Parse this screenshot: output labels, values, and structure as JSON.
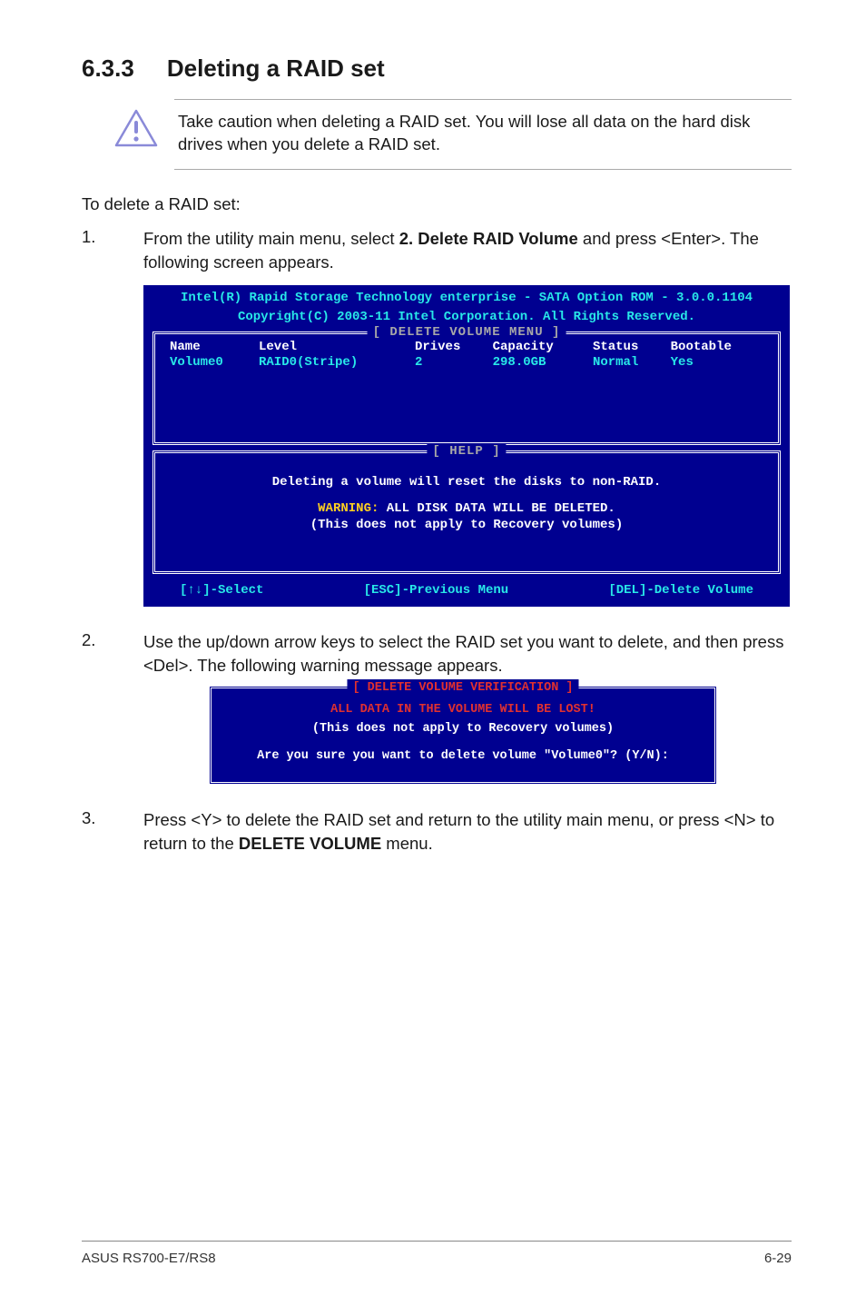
{
  "heading": {
    "number": "6.3.3",
    "title": "Deleting a RAID set"
  },
  "caution": "Take caution when deleting a RAID set. You will lose all data on the hard disk drives when you delete a RAID set.",
  "intro": "To delete a RAID set:",
  "steps": {
    "1": {
      "num": "1.",
      "pre": "From the utility main menu, select ",
      "bold": "2. Delete RAID Volume",
      "post": " and press <Enter>. The following screen appears."
    },
    "2": {
      "num": "2.",
      "text": "Use the up/down arrow keys to select the RAID set you want to delete, and then press <Del>. The following warning message appears."
    },
    "3": {
      "num": "3.",
      "pre": "Press <Y> to delete the RAID set and return to the utility main menu, or press <N> to return to the ",
      "bold": "DELETE VOLUME",
      "post": " menu."
    }
  },
  "bios": {
    "header1": "Intel(R) Rapid Storage Technology enterprise - SATA Option ROM - 3.0.0.1104",
    "header2": "Copyright(C) 2003-11 Intel Corporation.  All Rights Reserved.",
    "frame_title": "[ DELETE VOLUME MENU ]",
    "cols": {
      "name": "Name",
      "level": "Level",
      "drives": "Drives",
      "capacity": "Capacity",
      "status": "Status",
      "bootable": "Bootable"
    },
    "row": {
      "name": "Volume0",
      "level": "RAID0(Stripe)",
      "drives": "2",
      "capacity": "298.0GB",
      "status": "Normal",
      "bootable": "Yes"
    },
    "help_title": "[ HELP ]",
    "help_line1": "Deleting a volume will reset the disks to non-RAID.",
    "help_warn_label": "WARNING:",
    "help_warn_text": " ALL DISK DATA WILL BE DELETED.",
    "help_line3": "(This does not apply to Recovery volumes)",
    "foot_select": "[↑↓]-Select",
    "foot_prev": "[ESC]-Previous Menu",
    "foot_del": "[DEL]-Delete Volume"
  },
  "dialog": {
    "title": "[ DELETE VOLUME VERIFICATION ]",
    "line1": "ALL DATA IN THE VOLUME WILL BE LOST!",
    "line2": "(This does not apply to Recovery volumes)",
    "line3": "Are you sure you want to delete volume \"Volume0\"? (Y/N):"
  },
  "footer": {
    "left": "ASUS RS700-E7/RS8",
    "right": "6-29"
  }
}
